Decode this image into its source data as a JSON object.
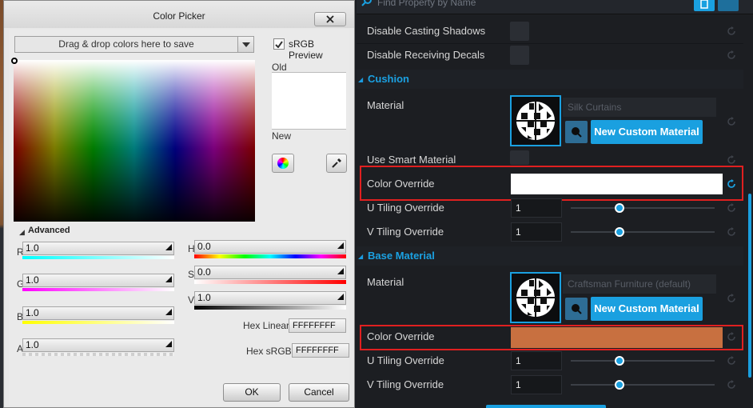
{
  "picker": {
    "title": "Color Picker",
    "swatch_placeholder": "Drag & drop colors here to save",
    "srgb_label": "sRGB Preview",
    "srgb_checked": true,
    "old_label": "Old",
    "new_label": "New",
    "old_color": "#ffffff",
    "new_color": "#ffffff",
    "advanced_label": "Advanced",
    "channels_rgb": [
      {
        "label": "R",
        "value": "1.0"
      },
      {
        "label": "G",
        "value": "1.0"
      },
      {
        "label": "B",
        "value": "1.0"
      },
      {
        "label": "A",
        "value": "1.0"
      }
    ],
    "channels_hsv": [
      {
        "label": "H",
        "value": "0.0"
      },
      {
        "label": "S",
        "value": "0.0"
      },
      {
        "label": "V",
        "value": "1.0"
      }
    ],
    "hex_linear_label": "Hex Linear",
    "hex_linear_value": "FFFFFFFF",
    "hex_srgb_label": "Hex sRGB",
    "hex_srgb_value": "FFFFFFFF",
    "ok_label": "OK",
    "cancel_label": "Cancel"
  },
  "details": {
    "search_placeholder": "Find Property by Name",
    "rows_top": [
      {
        "label": "Disable Casting Shadows"
      },
      {
        "label": "Disable Receiving Decals"
      }
    ],
    "sections": [
      {
        "title": "Cushion",
        "material_label": "Material",
        "material_name": "Silk Curtains",
        "new_material_label": "New Custom Material",
        "smart_label": "Use Smart Material",
        "override_label": "Color Override",
        "override_color": "#ffffff",
        "u_label": "U Tiling Override",
        "u_value": "1",
        "v_label": "V Tiling Override",
        "v_value": "1"
      },
      {
        "title": "Base Material",
        "material_label": "Material",
        "material_name": "Craftsman Furniture (default)",
        "new_material_label": "New Custom Material",
        "override_label": "Color Override",
        "override_color": "#c87040",
        "u_label": "U Tiling Override",
        "u_value": "1",
        "v_label": "V Tiling Override",
        "v_value": "1"
      }
    ],
    "accent_color": "#1aa0e0",
    "highlight_color": "#e02020"
  }
}
